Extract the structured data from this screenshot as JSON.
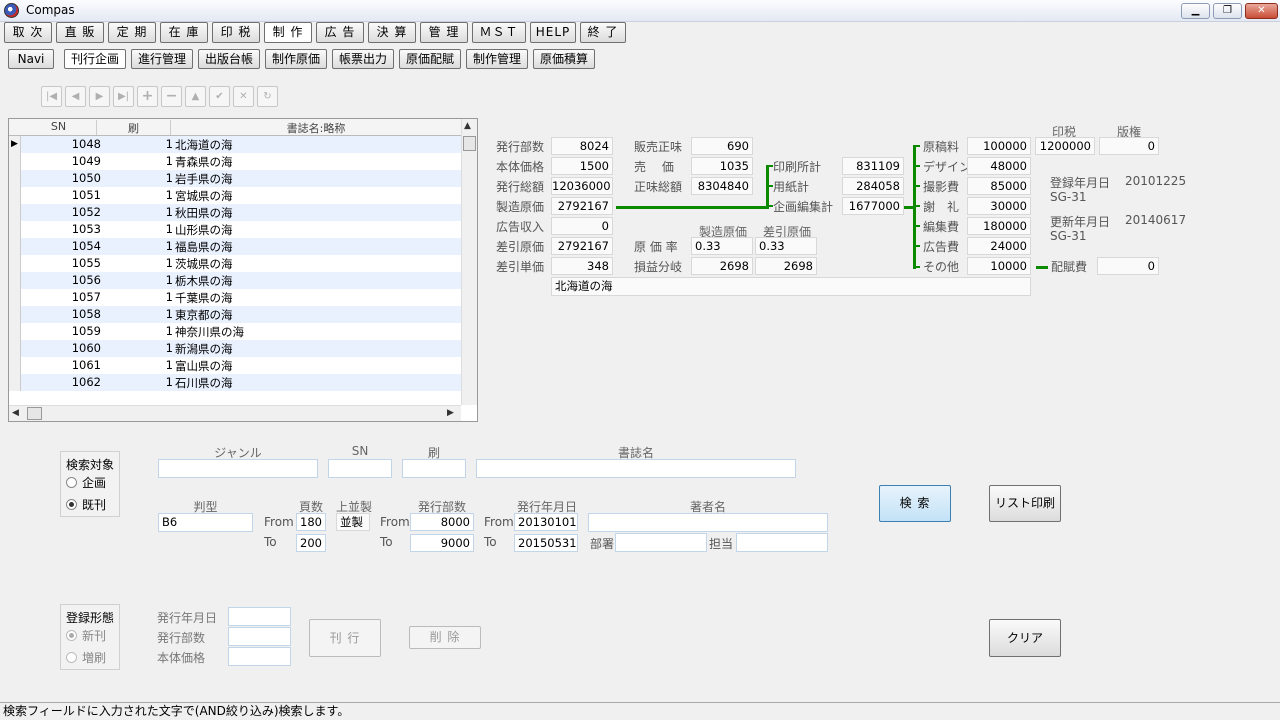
{
  "window": {
    "title": "Compas",
    "minimize": "▁",
    "restore": "❐",
    "close": "✕"
  },
  "menu": [
    "取 次",
    "直 販",
    "定 期",
    "在 庫",
    "印 税",
    "制 作",
    "広 告",
    "決 算",
    "管 理",
    "ＭＳＴ",
    "HELP",
    "終 了"
  ],
  "subtabs": [
    "Navi",
    "刊行企画",
    "進行管理",
    "出版台帳",
    "制作原価",
    "帳票出力",
    "原価配賦",
    "制作管理",
    "原価積算"
  ],
  "grid": {
    "headers": {
      "sn": "SN",
      "print": "刷",
      "name": "書誌名:略称"
    },
    "rows": [
      {
        "sn": "1048",
        "print": "1",
        "name": "北海道の海"
      },
      {
        "sn": "1049",
        "print": "1",
        "name": "青森県の海"
      },
      {
        "sn": "1050",
        "print": "1",
        "name": "岩手県の海"
      },
      {
        "sn": "1051",
        "print": "1",
        "name": "宮城県の海"
      },
      {
        "sn": "1052",
        "print": "1",
        "name": "秋田県の海"
      },
      {
        "sn": "1053",
        "print": "1",
        "name": "山形県の海"
      },
      {
        "sn": "1054",
        "print": "1",
        "name": "福島県の海"
      },
      {
        "sn": "1055",
        "print": "1",
        "name": "茨城県の海"
      },
      {
        "sn": "1056",
        "print": "1",
        "name": "栃木県の海"
      },
      {
        "sn": "1057",
        "print": "1",
        "name": "千葉県の海"
      },
      {
        "sn": "1058",
        "print": "1",
        "name": "東京都の海"
      },
      {
        "sn": "1059",
        "print": "1",
        "name": "神奈川県の海"
      },
      {
        "sn": "1060",
        "print": "1",
        "name": "新潟県の海"
      },
      {
        "sn": "1061",
        "print": "1",
        "name": "富山県の海"
      },
      {
        "sn": "1062",
        "print": "1",
        "name": "石川県の海"
      }
    ]
  },
  "detail": {
    "hakko_busu": {
      "label": "発行部数",
      "value": "8024"
    },
    "hontai_kakaku": {
      "label": "本体価格",
      "value": "1500"
    },
    "hakko_sogaku": {
      "label": "発行総額",
      "value": "12036000"
    },
    "seizo_genka": {
      "label": "製造原価",
      "value": "2792167"
    },
    "kokoku_shunyu": {
      "label": "広告収入",
      "value": "0"
    },
    "sashihiki_genka": {
      "label": "差引原価",
      "value": "2792167"
    },
    "sashihiki_tanka": {
      "label": "差引単価",
      "value": "348"
    },
    "hanbai_shomi": {
      "label": "販売正味",
      "value": "690"
    },
    "baika": {
      "label": "売　 価",
      "value": "1035"
    },
    "shomi_sogaku": {
      "label": "正味総額",
      "value": "8304840"
    },
    "genka_ritsu": {
      "label": "原 価 率",
      "value1": "0.33",
      "value2": "0.33"
    },
    "soneki_bunki": {
      "label": "損益分岐",
      "value1": "2698",
      "value2": "2698"
    },
    "col_seizo": "製造原価",
    "col_sashihiki": "差引原価",
    "insatsu_kei": {
      "label": "印刷所計",
      "value": "831109"
    },
    "yoshi_kei": {
      "label": "用紙計",
      "value": "284058"
    },
    "kikaku_henshu_kei": {
      "label": "企画編集計",
      "value": "1677000"
    },
    "genkoryo": {
      "label": "原稿料",
      "value": "100000"
    },
    "design": {
      "label": "デザイン",
      "value": "48000"
    },
    "satsuei": {
      "label": "撮影費",
      "value": "85000"
    },
    "sharei": {
      "label": "謝　礼",
      "value": "30000"
    },
    "henshu": {
      "label": "編集費",
      "value": "180000"
    },
    "kokoku_hi": {
      "label": "広告費",
      "value": "24000"
    },
    "sonota": {
      "label": "その他",
      "value": "10000"
    },
    "haifu_hi": {
      "label": "配賦費",
      "value": "0"
    },
    "inzei": {
      "label": "印税",
      "value": "1200000"
    },
    "hanken": {
      "label": "版権",
      "value": "0"
    },
    "toroku": {
      "label": "登録年月日",
      "date": "20101225",
      "user": "SG-31"
    },
    "koshin": {
      "label": "更新年月日",
      "date": "20140617",
      "user": "SG-31"
    },
    "title_name": "北海道の海"
  },
  "search": {
    "target_label": "検索対象",
    "opt_kikaku": "企画",
    "opt_kikan": "既刊",
    "genre": "ジャンル",
    "sn": "SN",
    "print": "刷",
    "shoshimei": "書誌名",
    "hankei": "判型",
    "hankei_value": "B6",
    "pages": "頁数",
    "pages_from": "180",
    "pages_to": "200",
    "binding": "上並製",
    "binding_value": "並製",
    "busu": "発行部数",
    "busu_from": "8000",
    "busu_to": "9000",
    "date": "発行年月日",
    "date_from": "20130101",
    "date_to": "20150531",
    "author": "著者名",
    "from": "From",
    "to": "To",
    "busho": "部署",
    "tanto": "担当",
    "search_btn": "検 索",
    "list_print_btn": "リスト印刷"
  },
  "register": {
    "label": "登録形態",
    "opt_new": "新刊",
    "opt_reprint": "増刷",
    "date": "発行年月日",
    "busu": "発行部数",
    "price": "本体価格",
    "kankou_btn": "刊 行",
    "delete_btn": "削 除",
    "clear_btn": "クリア"
  },
  "status": "検索フィールドに入力された文字で(AND絞り込み)検索します。"
}
